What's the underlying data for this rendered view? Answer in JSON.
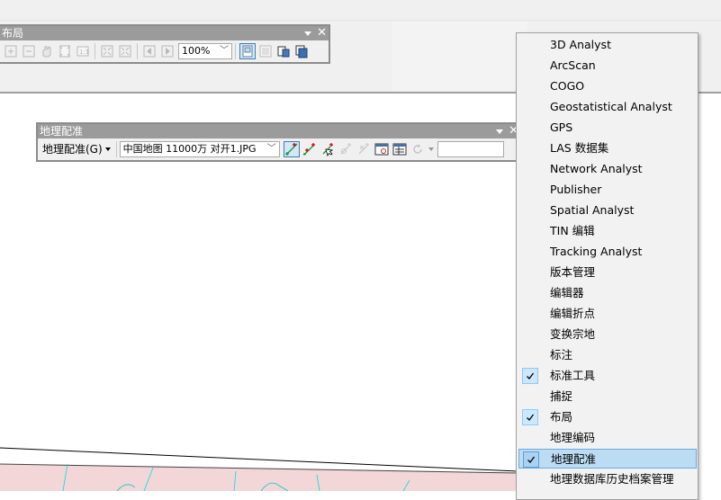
{
  "layout_toolbar": {
    "title": "布局",
    "zoom_value": "100%"
  },
  "georef_toolbar": {
    "title": "地理配准",
    "menu_label": "地理配准(G)",
    "layer_value": "中国地图 11000万 对开1.JPG",
    "coord_input_value": ""
  },
  "context_menu": {
    "items": [
      {
        "label": "3D Analyst",
        "checked": false
      },
      {
        "label": "ArcScan",
        "checked": false
      },
      {
        "label": "COGO",
        "checked": false
      },
      {
        "label": "Geostatistical Analyst",
        "checked": false
      },
      {
        "label": "GPS",
        "checked": false
      },
      {
        "label": "LAS 数据集",
        "checked": false
      },
      {
        "label": "Network Analyst",
        "checked": false
      },
      {
        "label": "Publisher",
        "checked": false
      },
      {
        "label": "Spatial Analyst",
        "checked": false
      },
      {
        "label": "TIN 编辑",
        "checked": false
      },
      {
        "label": "Tracking Analyst",
        "checked": false
      },
      {
        "label": "版本管理",
        "checked": false
      },
      {
        "label": "编辑器",
        "checked": false
      },
      {
        "label": "编辑折点",
        "checked": false
      },
      {
        "label": "变换宗地",
        "checked": false
      },
      {
        "label": "标注",
        "checked": false
      },
      {
        "label": "标准工具",
        "checked": true
      },
      {
        "label": "捕捉",
        "checked": false
      },
      {
        "label": "布局",
        "checked": true
      },
      {
        "label": "地理编码",
        "checked": false
      },
      {
        "label": "地理配准",
        "checked": true,
        "highlighted": true
      },
      {
        "label": "地理数据库历史档案管理",
        "checked": false
      }
    ]
  },
  "colors": {
    "title_bar": "#9b9b9b",
    "menu_bg": "#f2f2f2",
    "highlight": "#bcdcf4",
    "check_bg": "#cce8ff",
    "map_fill": "#f2d6d8",
    "map_line": "#00e0e0"
  }
}
